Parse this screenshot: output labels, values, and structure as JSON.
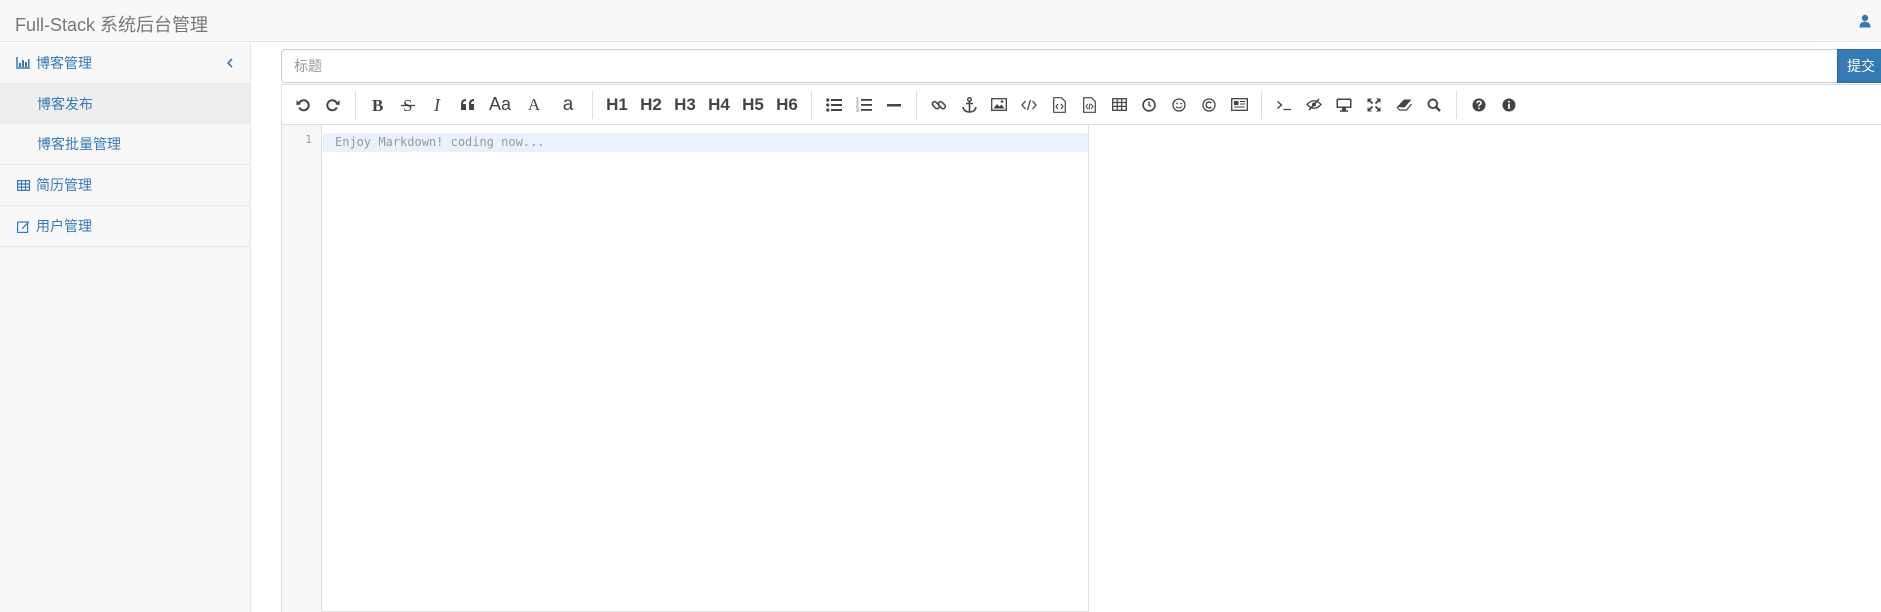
{
  "header": {
    "brand": "Full-Stack 系统后台管理"
  },
  "sidebar": {
    "groups": [
      {
        "label": "博客管理",
        "icon": "bar-chart-icon",
        "expanded": true,
        "items": [
          {
            "label": "博客发布",
            "active": true
          },
          {
            "label": "博客批量管理",
            "active": false
          }
        ]
      },
      {
        "label": "简历管理",
        "icon": "table-icon"
      },
      {
        "label": "用户管理",
        "icon": "edit-icon"
      }
    ]
  },
  "form": {
    "title_placeholder": "标题",
    "title_value": "",
    "submit_label": "提交"
  },
  "editor": {
    "line_number": "1",
    "placeholder": "Enjoy Markdown! coding now...",
    "toolbar": {
      "headings": [
        "H1",
        "H2",
        "H3",
        "H4",
        "H5",
        "H6"
      ],
      "case_upper": "Aa",
      "case_single": "A",
      "case_lower": "a"
    }
  },
  "colors": {
    "accent": "#337ab7",
    "sidebar_bg": "#f8f8f8",
    "active_line": "#e8f2fe"
  }
}
